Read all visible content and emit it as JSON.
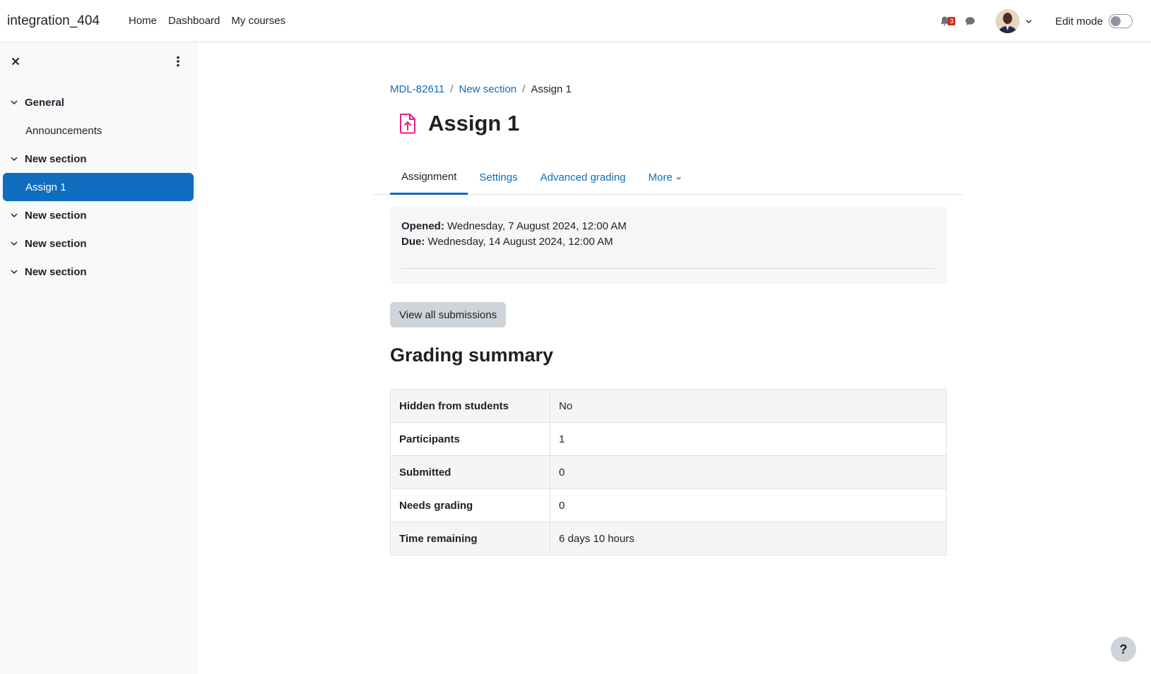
{
  "navbar": {
    "site_name": "integration_404",
    "links": [
      "Home",
      "Dashboard",
      "My courses"
    ],
    "notification_count": "3",
    "edit_mode_label": "Edit mode"
  },
  "course_index": {
    "sections": [
      {
        "title": "General",
        "items": [
          "Announcements"
        ]
      },
      {
        "title": "New section",
        "items": [
          "Assign 1"
        ]
      },
      {
        "title": "New section",
        "items": []
      },
      {
        "title": "New section",
        "items": []
      },
      {
        "title": "New section",
        "items": []
      }
    ],
    "active_item": "Assign 1"
  },
  "breadcrumb": [
    "MDL-82611",
    "New section",
    "Assign 1"
  ],
  "page_title": "Assign 1",
  "tabs": {
    "assignment": "Assignment",
    "settings": "Settings",
    "advanced_grading": "Advanced grading",
    "more": "More"
  },
  "dates": {
    "opened_label": "Opened:",
    "opened_value": "Wednesday, 7 August 2024, 12:00 AM",
    "due_label": "Due:",
    "due_value": "Wednesday, 14 August 2024, 12:00 AM"
  },
  "view_all_button": "View all submissions",
  "grading_summary": {
    "heading": "Grading summary",
    "rows": [
      {
        "label": "Hidden from students",
        "value": "No"
      },
      {
        "label": "Participants",
        "value": "1"
      },
      {
        "label": "Submitted",
        "value": "0"
      },
      {
        "label": "Needs grading",
        "value": "0"
      },
      {
        "label": "Time remaining",
        "value": "6 days 10 hours"
      }
    ]
  },
  "help_button": "?",
  "colors": {
    "primary": "#0f6cbf",
    "badge": "#ca3120",
    "assign_icon": "#e41c8b"
  }
}
